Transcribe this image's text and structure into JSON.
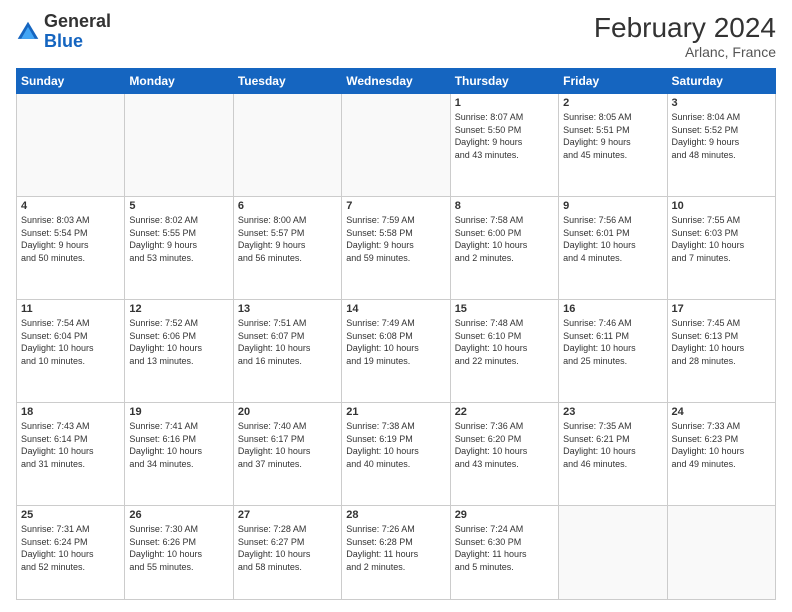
{
  "header": {
    "logo": {
      "general": "General",
      "blue": "Blue"
    },
    "title": "February 2024",
    "location": "Arlanc, France"
  },
  "days_of_week": [
    "Sunday",
    "Monday",
    "Tuesday",
    "Wednesday",
    "Thursday",
    "Friday",
    "Saturday"
  ],
  "weeks": [
    [
      {
        "day": "",
        "info": ""
      },
      {
        "day": "",
        "info": ""
      },
      {
        "day": "",
        "info": ""
      },
      {
        "day": "",
        "info": ""
      },
      {
        "day": "1",
        "info": "Sunrise: 8:07 AM\nSunset: 5:50 PM\nDaylight: 9 hours\nand 43 minutes."
      },
      {
        "day": "2",
        "info": "Sunrise: 8:05 AM\nSunset: 5:51 PM\nDaylight: 9 hours\nand 45 minutes."
      },
      {
        "day": "3",
        "info": "Sunrise: 8:04 AM\nSunset: 5:52 PM\nDaylight: 9 hours\nand 48 minutes."
      }
    ],
    [
      {
        "day": "4",
        "info": "Sunrise: 8:03 AM\nSunset: 5:54 PM\nDaylight: 9 hours\nand 50 minutes."
      },
      {
        "day": "5",
        "info": "Sunrise: 8:02 AM\nSunset: 5:55 PM\nDaylight: 9 hours\nand 53 minutes."
      },
      {
        "day": "6",
        "info": "Sunrise: 8:00 AM\nSunset: 5:57 PM\nDaylight: 9 hours\nand 56 minutes."
      },
      {
        "day": "7",
        "info": "Sunrise: 7:59 AM\nSunset: 5:58 PM\nDaylight: 9 hours\nand 59 minutes."
      },
      {
        "day": "8",
        "info": "Sunrise: 7:58 AM\nSunset: 6:00 PM\nDaylight: 10 hours\nand 2 minutes."
      },
      {
        "day": "9",
        "info": "Sunrise: 7:56 AM\nSunset: 6:01 PM\nDaylight: 10 hours\nand 4 minutes."
      },
      {
        "day": "10",
        "info": "Sunrise: 7:55 AM\nSunset: 6:03 PM\nDaylight: 10 hours\nand 7 minutes."
      }
    ],
    [
      {
        "day": "11",
        "info": "Sunrise: 7:54 AM\nSunset: 6:04 PM\nDaylight: 10 hours\nand 10 minutes."
      },
      {
        "day": "12",
        "info": "Sunrise: 7:52 AM\nSunset: 6:06 PM\nDaylight: 10 hours\nand 13 minutes."
      },
      {
        "day": "13",
        "info": "Sunrise: 7:51 AM\nSunset: 6:07 PM\nDaylight: 10 hours\nand 16 minutes."
      },
      {
        "day": "14",
        "info": "Sunrise: 7:49 AM\nSunset: 6:08 PM\nDaylight: 10 hours\nand 19 minutes."
      },
      {
        "day": "15",
        "info": "Sunrise: 7:48 AM\nSunset: 6:10 PM\nDaylight: 10 hours\nand 22 minutes."
      },
      {
        "day": "16",
        "info": "Sunrise: 7:46 AM\nSunset: 6:11 PM\nDaylight: 10 hours\nand 25 minutes."
      },
      {
        "day": "17",
        "info": "Sunrise: 7:45 AM\nSunset: 6:13 PM\nDaylight: 10 hours\nand 28 minutes."
      }
    ],
    [
      {
        "day": "18",
        "info": "Sunrise: 7:43 AM\nSunset: 6:14 PM\nDaylight: 10 hours\nand 31 minutes."
      },
      {
        "day": "19",
        "info": "Sunrise: 7:41 AM\nSunset: 6:16 PM\nDaylight: 10 hours\nand 34 minutes."
      },
      {
        "day": "20",
        "info": "Sunrise: 7:40 AM\nSunset: 6:17 PM\nDaylight: 10 hours\nand 37 minutes."
      },
      {
        "day": "21",
        "info": "Sunrise: 7:38 AM\nSunset: 6:19 PM\nDaylight: 10 hours\nand 40 minutes."
      },
      {
        "day": "22",
        "info": "Sunrise: 7:36 AM\nSunset: 6:20 PM\nDaylight: 10 hours\nand 43 minutes."
      },
      {
        "day": "23",
        "info": "Sunrise: 7:35 AM\nSunset: 6:21 PM\nDaylight: 10 hours\nand 46 minutes."
      },
      {
        "day": "24",
        "info": "Sunrise: 7:33 AM\nSunset: 6:23 PM\nDaylight: 10 hours\nand 49 minutes."
      }
    ],
    [
      {
        "day": "25",
        "info": "Sunrise: 7:31 AM\nSunset: 6:24 PM\nDaylight: 10 hours\nand 52 minutes."
      },
      {
        "day": "26",
        "info": "Sunrise: 7:30 AM\nSunset: 6:26 PM\nDaylight: 10 hours\nand 55 minutes."
      },
      {
        "day": "27",
        "info": "Sunrise: 7:28 AM\nSunset: 6:27 PM\nDaylight: 10 hours\nand 58 minutes."
      },
      {
        "day": "28",
        "info": "Sunrise: 7:26 AM\nSunset: 6:28 PM\nDaylight: 11 hours\nand 2 minutes."
      },
      {
        "day": "29",
        "info": "Sunrise: 7:24 AM\nSunset: 6:30 PM\nDaylight: 11 hours\nand 5 minutes."
      },
      {
        "day": "",
        "info": ""
      },
      {
        "day": "",
        "info": ""
      }
    ]
  ]
}
